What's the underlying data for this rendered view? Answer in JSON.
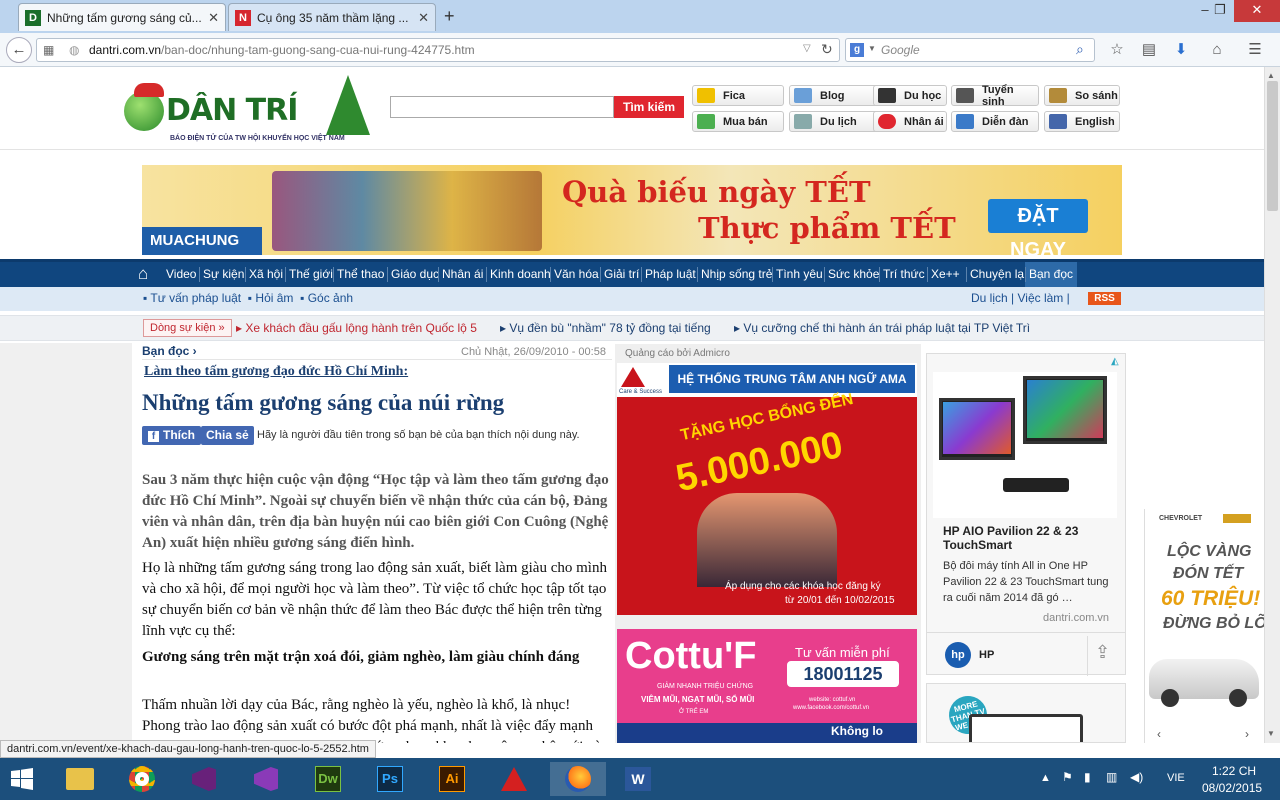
{
  "browser": {
    "tabs": [
      {
        "title": "Những tấm gương sáng củ..."
      },
      {
        "title": "Cụ ông 35 năm thầm lặng ..."
      }
    ],
    "url_domain": "dantri.com.vn",
    "url_path": "/ban-doc/nhung-tam-guong-sang-cua-nui-rung-424775.htm",
    "search_placeholder": "Google",
    "status_url": "dantri.com.vn/event/xe-khach-dau-gau-long-hanh-tren-quoc-lo-5-2552.htm"
  },
  "header": {
    "logo_text": "DÂN TRÍ",
    "logo_tagline": "BÁO ĐIỆN TỬ CỦA TW HỘI KHUYẾN HỌC VIỆT NAM",
    "search_button": "Tìm kiếm",
    "quick_links": [
      "Fica",
      "Blog",
      "Du học",
      "Tuyển sinh",
      "So sánh",
      "Mua bán",
      "Du lịch",
      "Nhân ái",
      "Diễn đàn",
      "English"
    ]
  },
  "banner": {
    "brand": "MUACHUNG",
    "line1": "Quà biếu ngày TẾT",
    "line2": "Thực phẩm TẾT",
    "cta": "ĐẶT NGAY"
  },
  "nav": {
    "items": [
      "Video",
      "Sự kiện",
      "Xã hội",
      "Thế giới",
      "Thể thao",
      "Giáo dục",
      "Nhân ái",
      "Kinh doanh",
      "Văn hóa",
      "Giải trí",
      "Pháp luật",
      "Nhịp sống trẻ",
      "Tình yêu",
      "Sức khỏe",
      "Trí thức",
      "Xe++",
      "Chuyện lạ",
      "Bạn đọc"
    ],
    "sub_items": [
      "Tư vấn pháp luật",
      "Hỏi âm",
      "Góc ảnh"
    ],
    "right_links": [
      "Du lịch",
      "Việc làm"
    ],
    "rss": "RSS"
  },
  "ticker": {
    "label": "Dòng sự kiện",
    "items": [
      "Xe khách đầu gấu lộng hành trên Quốc lộ 5",
      "Vụ đền bù \"nhầm\" 78 tỷ đồng tại tiếng",
      "Vụ cưỡng chế thi hành án trái pháp luật tại TP Việt Trì"
    ]
  },
  "article": {
    "section": "Bạn đọc",
    "date": "Chủ Nhật, 26/09/2010 - 00:58",
    "kicker": "Làm theo tấm gương đạo đức Hồ Chí Minh:",
    "title": "Những tấm gương sáng của núi rừng",
    "like_label": "Thích",
    "share_label": "Chia sẻ",
    "social_text": "Hãy là người đầu tiên trong số bạn bè của bạn thích nội dung này.",
    "lead": "Sau 3 năm thực hiện cuộc vận động “Học tập và làm theo tấm gương đạo đức Hồ Chí Minh”. Ngoài sự chuyển biến về nhận thức của cán bộ, Đảng viên và nhân dân, trên địa bàn huyện núi cao biên giới Con Cuông (Nghệ An) xuất hiện nhiều gương sáng điển hình.",
    "para1": "Họ là những tấm gương sáng trong lao động sản xuất, biết làm giàu cho mình và cho xã hội, để mọi người học và làm theo”. Từ việc tổ chức học tập tốt tạo sự chuyển biến cơ bản về nhận thức để làm theo Bác được thể hiện trên từng lĩnh vực cụ thể:",
    "subhead": "Gương sáng trên mặt trận xoá đói, giảm nghèo, làm giàu chính đáng",
    "para2": "Thấm nhuần lời dạy của Bác, rằng nghèo là yếu, nghèo là khổ, là nhục! Phong trào lao động sản xuất có bước đột phá mạnh, nhất là việc đẩy mạnh chuyển đổi cơ cấu cây trồng, vật nuôi, ứng dụng khoa học công nghệ mới vào sản"
  },
  "ads": {
    "label": "Quảng cáo bởi Admicro",
    "ama_title": "HỆ THỐNG TRUNG TÂM ANH NGỮ AMA",
    "ama_sub": "Care & Success",
    "ama_promo": "TẶNG HỌC BỔNG ĐẾN",
    "ama_amount": "5.000.000",
    "ama_note1": "Áp dụng cho các khóa học đăng ký",
    "ama_note2": "từ 20/01 đến 10/02/2015",
    "cottu_brand": "Cottu'F",
    "cottu_tagline": "GIẢM NHANH TRIỆU CHỨNG",
    "cottu_symptoms": "VIÊM MŨI, NGẠT MŨI, SỔ MŨI",
    "cottu_age": "Ở TRẺ EM",
    "cottu_consult": "Tư vấn miễn phí",
    "cottu_phone": "18001125",
    "cottu_web1": "website: cottuf.vn",
    "cottu_web2": "www.facebook.com/cottuf.vn",
    "cottu_bottom": "Không lo",
    "hp_title": "HP AIO Pavilion 22 & 23 TouchSmart",
    "hp_desc": "Bộ đôi máy tính All in One HP Pavilion 22 & 23 TouchSmart tung ra cuối năm 2014 đã gó …",
    "hp_source": "dantri.com.vn",
    "hp_brand": "HP",
    "tv_badge": "MORE THAN TV WE SEE",
    "chev_brand": "CHEVROLET",
    "chev_line1": "LỘC VÀNG",
    "chev_line2": "ĐÓN TẾT",
    "chev_line3": "60 TRIỆU!",
    "chev_line4": "ĐỪNG BỎ LỠ"
  },
  "taskbar": {
    "language": "VIE",
    "time": "1:22 CH",
    "date": "08/02/2015"
  }
}
